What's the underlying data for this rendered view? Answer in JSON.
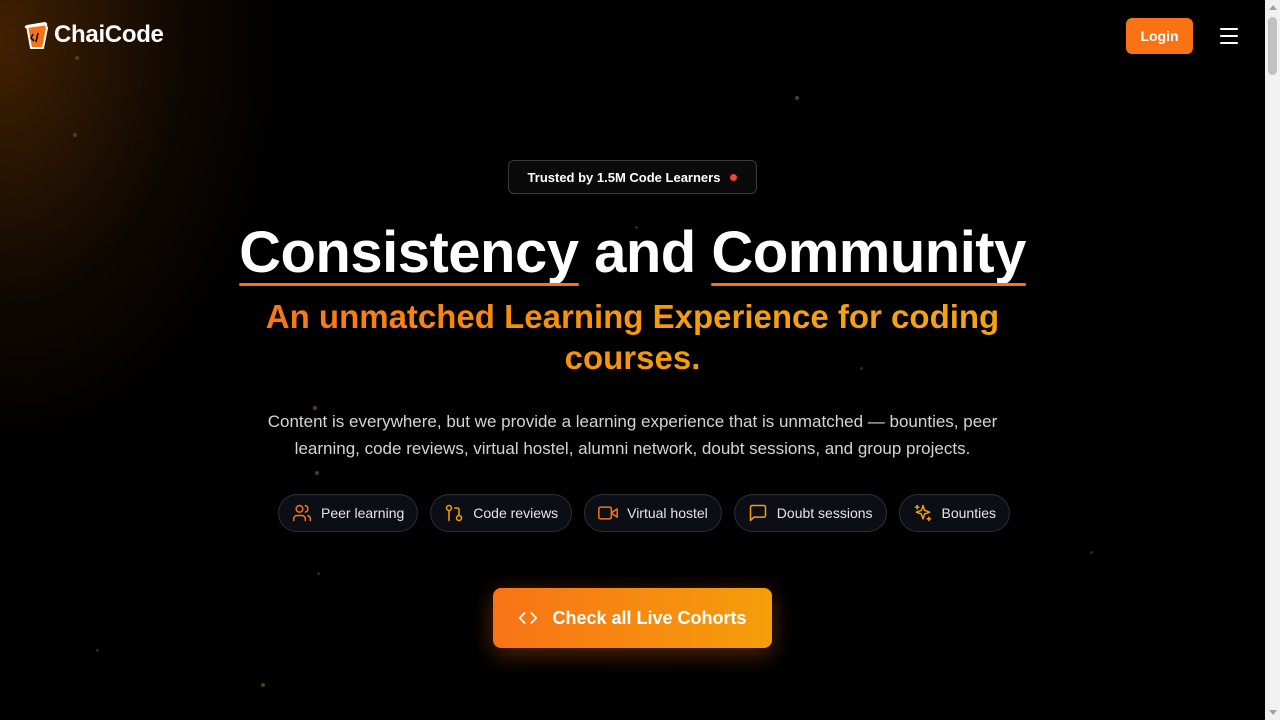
{
  "header": {
    "brand": "ChaiCode",
    "login_label": "Login"
  },
  "hero": {
    "badge_text": "Trusted by 1.5M Code Learners",
    "headline": {
      "word1": "Consistency",
      "connector": "and",
      "word2": "Community"
    },
    "subhead": "An unmatched Learning Experience for coding courses.",
    "description": "Content is everywhere, but we provide a learning experience that is unmatched — bounties, peer learning, code reviews, virtual hostel, alumni network, doubt sessions, and group projects.",
    "features": [
      {
        "label": "Peer learning",
        "icon": "users-icon"
      },
      {
        "label": "Code reviews",
        "icon": "git-pull-request-icon"
      },
      {
        "label": "Virtual hostel",
        "icon": "video-icon"
      },
      {
        "label": "Doubt sessions",
        "icon": "message-square-icon"
      },
      {
        "label": "Bounties",
        "icon": "sparkles-icon"
      }
    ],
    "cta_label": "Check all Live Cohorts"
  },
  "colors": {
    "accent": "#f97316",
    "accent_secondary": "#f59e0b",
    "background": "#000000",
    "badge_dot": "#ef4444"
  }
}
